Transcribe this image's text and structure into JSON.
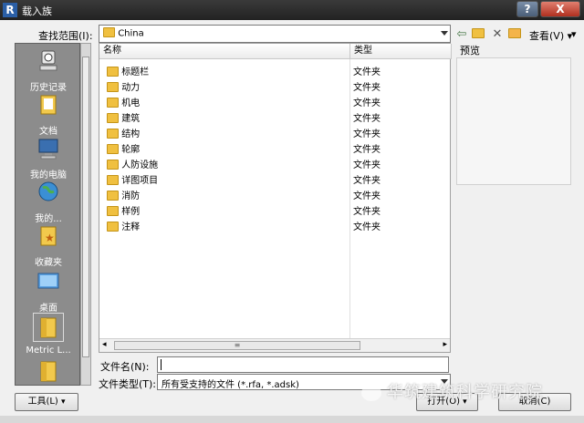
{
  "window": {
    "title": "载入族",
    "help": "?",
    "close": "X"
  },
  "lookin": {
    "label": "查找范围(I):",
    "value": "China"
  },
  "toolbar": {
    "views_label": "查看(V)",
    "preview_label": "预览"
  },
  "places": [
    {
      "name": "history",
      "label": "历史记录",
      "icon": "history-icon"
    },
    {
      "name": "documents",
      "label": "文档",
      "icon": "documents-icon"
    },
    {
      "name": "my-computer",
      "label": "我的电脑",
      "icon": "computer-icon"
    },
    {
      "name": "my-network",
      "label": "我的...",
      "icon": "network-icon"
    },
    {
      "name": "favorites",
      "label": "收藏夹",
      "icon": "favorites-icon"
    },
    {
      "name": "desktop",
      "label": "桌面",
      "icon": "desktop-icon"
    },
    {
      "name": "metric",
      "label": "Metric L...",
      "icon": "folder-icon"
    },
    {
      "name": "folder-extra",
      "label": "",
      "icon": "folder-icon"
    }
  ],
  "list": {
    "headers": {
      "name": "名称",
      "type": "类型"
    },
    "items": [
      {
        "name": "标题栏",
        "type": "文件夹"
      },
      {
        "name": "动力",
        "type": "文件夹"
      },
      {
        "name": "机电",
        "type": "文件夹"
      },
      {
        "name": "建筑",
        "type": "文件夹"
      },
      {
        "name": "结构",
        "type": "文件夹"
      },
      {
        "name": "轮廓",
        "type": "文件夹"
      },
      {
        "name": "人防设施",
        "type": "文件夹"
      },
      {
        "name": "详图项目",
        "type": "文件夹"
      },
      {
        "name": "消防",
        "type": "文件夹"
      },
      {
        "name": "样例",
        "type": "文件夹"
      },
      {
        "name": "注释",
        "type": "文件夹"
      }
    ]
  },
  "filename": {
    "label": "文件名(N):",
    "value": ""
  },
  "filetype": {
    "label": "文件类型(T):",
    "value": "所有受支持的文件 (*.rfa, *.adsk)"
  },
  "buttons": {
    "tools": "工具(L)",
    "open": "打开(O)",
    "cancel": "取消(C)"
  },
  "watermark": "华筑建筑科学研究院"
}
